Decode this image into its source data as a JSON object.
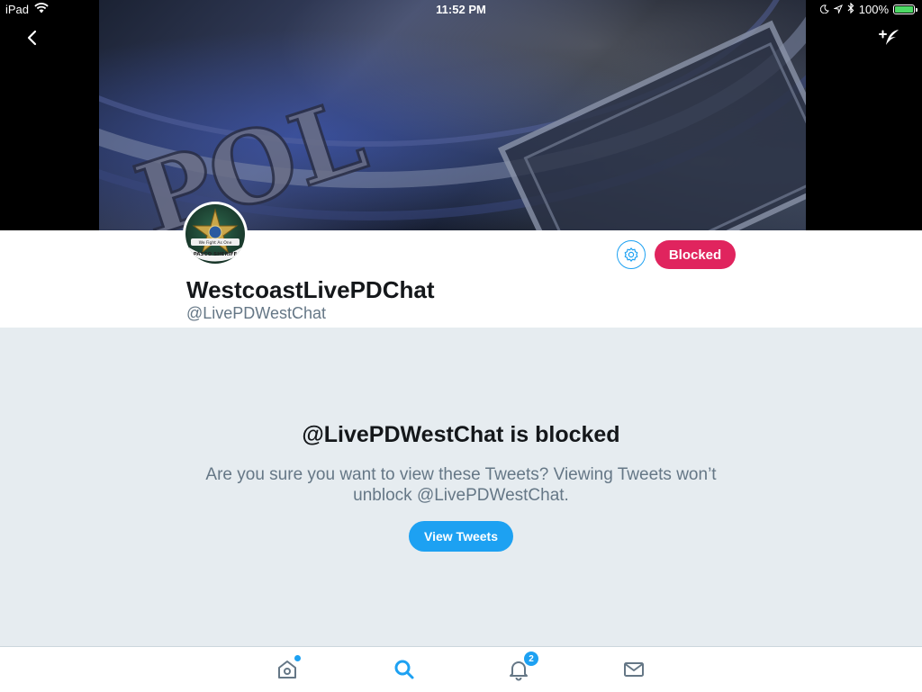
{
  "status_bar": {
    "device": "iPad",
    "time": "11:52 PM",
    "battery": "100%",
    "battery_level": 1.0
  },
  "profile": {
    "display_name": "WestcoastLivePDChat",
    "handle": "@LivePDWestChat",
    "blocked_button_label": "Blocked",
    "banner_text": "POL"
  },
  "avatar": {
    "seal_text": "PASCO SHERIFF",
    "motto": "We Fight As One"
  },
  "blocked_notice": {
    "title": "@LivePDWestChat is blocked",
    "description": "Are you sure you want to view these Tweets? Viewing Tweets won’t unblock @LivePDWestChat.",
    "view_button_label": "View Tweets"
  },
  "tab_bar": {
    "notifications_badge": "2"
  },
  "colors": {
    "twitter_blue": "#1da1f2",
    "blocked_red": "#e0245e",
    "background_gray": "#e6ecf0",
    "secondary_text": "#657786"
  },
  "icons": [
    "back-arrow-icon",
    "compose-tweet-icon",
    "settings-gear-icon",
    "home-icon",
    "search-icon",
    "notifications-bell-icon",
    "messages-envelope-icon",
    "wifi-icon",
    "moon-icon",
    "location-arrow-icon",
    "bluetooth-icon",
    "battery-icon"
  ]
}
